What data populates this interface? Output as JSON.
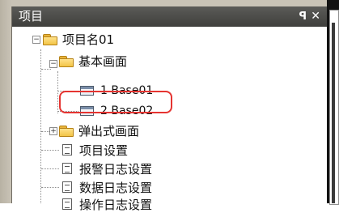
{
  "panel": {
    "title": "项目",
    "pin_glyph": "ꟼ",
    "close_glyph": "✕"
  },
  "tree": {
    "root": {
      "label": "项目名01",
      "expander": "−"
    },
    "base_folder": {
      "label": "基本画面",
      "expander": "−"
    },
    "screens": [
      {
        "label": "1 Base01"
      },
      {
        "label": "2 Base02",
        "highlighted": true
      }
    ],
    "popup_folder": {
      "label": "弹出式画面",
      "expander": "+"
    },
    "items": [
      {
        "label": "项目设置"
      },
      {
        "label": "报警日志设置"
      },
      {
        "label": "数据日志设置"
      },
      {
        "label": "操作日志设置"
      }
    ]
  },
  "colors": {
    "titlebar": "#4b4b48",
    "highlight_border": "#e53431",
    "folder": "#f2c447"
  }
}
